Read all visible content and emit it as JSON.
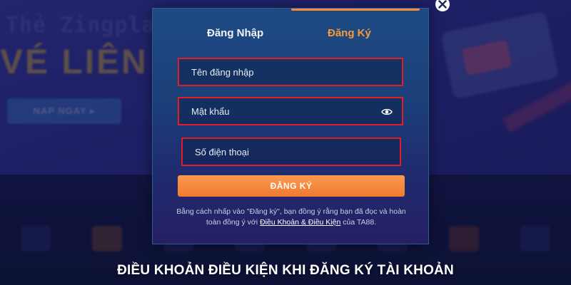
{
  "background": {
    "banner_title": "Thẻ Zingpla",
    "banner_subtitle": "VÉ LIÊN N",
    "cta_label": "NẠP NGAY ▸"
  },
  "modal": {
    "tabs": [
      {
        "label": "Đăng Nhập",
        "active": false
      },
      {
        "label": "Đăng Ký",
        "active": true
      }
    ],
    "fields": {
      "username": {
        "placeholder": "Tên đăng nhập",
        "value": ""
      },
      "password": {
        "placeholder": "Mật khẩu",
        "value": ""
      },
      "phone": {
        "placeholder": "Số điện thoại",
        "value": ""
      }
    },
    "submit_label": "ĐĂNG KÝ",
    "terms": {
      "prefix": "Bằng cách nhấp vào \"Đăng ký\", bạn đồng ý rằng bạn đã đọc và hoàn toàn đồng ý với ",
      "link": "Điều Khoản & Điều Kiện",
      "suffix": " của TA88."
    }
  },
  "caption": "ĐIỀU KHOẢN ĐIỀU KIỆN KHI ĐĂNG KÝ TÀI KHOẢN",
  "icons": [
    "eye-icon",
    "close-icon"
  ],
  "colors": {
    "accent": "#f59a3a",
    "highlight_border": "#e21d2a",
    "modal_bg": "#1e4b84",
    "submit_bg": "#f07a2e"
  }
}
